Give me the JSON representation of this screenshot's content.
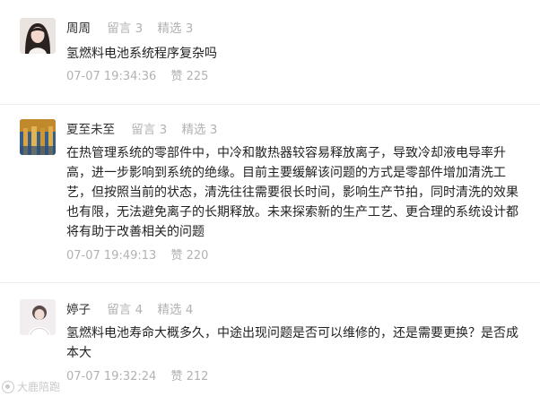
{
  "comments": [
    {
      "name": "周周",
      "messages_label": "留言 3",
      "featured_label": "精选 3",
      "text": "氢燃料电池系统程序复杂吗",
      "time": "07-07 19:34:36",
      "likes": "赞 225"
    },
    {
      "name": "夏至未至",
      "messages_label": "留言 3",
      "featured_label": "精选 3",
      "text": "在热管理系统的零部件中，中冷和散热器较容易释放离子，导致冷却液电导率升高，进一步影响到系统的绝缘。目前主要缓解该问题的方式是零部件增加清洗工艺，但按照当前的状态，清洗往往需要很长时间，影响生产节拍，同时清洗的效果也有限，无法避免离子的长期释放。未来探索新的生产工艺、更合理的系统设计都将有助于改善相关的问题",
      "time": "07-07 19:49:13",
      "likes": "赞 220"
    },
    {
      "name": "婷子",
      "messages_label": "留言 4",
      "featured_label": "精选 4",
      "text": "氢燃料电池寿命大概多久，中途出现问题是否可以维修的，还是需要更换？是否成本大",
      "time": "07-07 19:32:24",
      "likes": "赞 212"
    }
  ],
  "watermark": "大鹿陪跑"
}
